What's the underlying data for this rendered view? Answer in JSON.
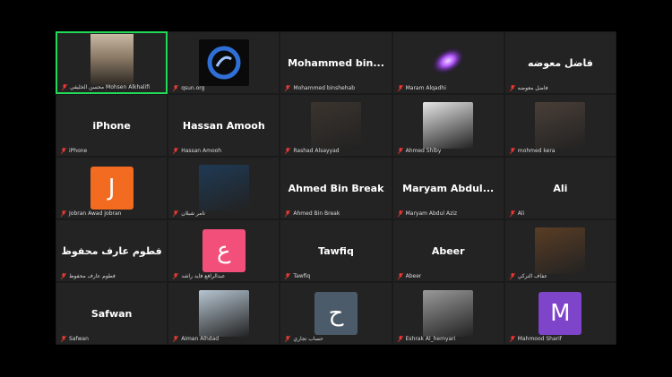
{
  "tiles": [
    {
      "label": "محسن الخليفي Mohsen Alkhalifi",
      "kind": "video",
      "active": true
    },
    {
      "label": "qsun.org",
      "kind": "logo"
    },
    {
      "label": "Mohammed binshehab",
      "center": "Mohammed  bin..."
    },
    {
      "label": "Maram Alqadhi",
      "kind": "galaxy"
    },
    {
      "label": "فاضل معوضه",
      "center": "فاضل معوضه"
    },
    {
      "label": "iPhone",
      "center": "iPhone"
    },
    {
      "label": "Hassan Amooh",
      "center": "Hassan Amooh"
    },
    {
      "label": "Rashad Alsayyad",
      "kind": "photo",
      "photo_color": "#3b342e"
    },
    {
      "label": "Ahmed Shlby",
      "kind": "photo",
      "photo_color": "#e6e6e6"
    },
    {
      "label": "mohmed kera",
      "kind": "photo",
      "photo_color": "#4a3f38"
    },
    {
      "label": "Jobran Awad Jobran",
      "kind": "avatar",
      "letter": "J",
      "avatar_color": "#f26b21"
    },
    {
      "label": "تامر شبلان",
      "kind": "photo",
      "photo_color": "#1f3a55"
    },
    {
      "label": "Ahmed Bin Break",
      "center": "Ahmed Bin Break"
    },
    {
      "label": "Maryam Abdul Aziz",
      "center": "Maryam  Abdul..."
    },
    {
      "label": "Ali",
      "center": "Ali"
    },
    {
      "label": "فطوم عارف محفوظ",
      "center": "فطوم عارف محفوظ"
    },
    {
      "label": "عبدالرافع فايد راشد",
      "kind": "avatar",
      "letter": "ع",
      "avatar_color": "#f2507b"
    },
    {
      "label": "Tawfiq",
      "center": "Tawfiq"
    },
    {
      "label": "Abeer",
      "center": "Abeer"
    },
    {
      "label": "عفاف التركي",
      "kind": "photo",
      "photo_color": "#5a3d25"
    },
    {
      "label": "Safwan",
      "center": "Safwan"
    },
    {
      "label": "Aiman Alhdad",
      "kind": "photo",
      "photo_color": "#b7c6d2"
    },
    {
      "label": "حساب تجاري",
      "kind": "avatar",
      "letter": "ح",
      "avatar_color": "#4c5b69"
    },
    {
      "label": "Eshrak Al_hemyari",
      "kind": "photo",
      "photo_color": "#9a9a9a"
    },
    {
      "label": "Mahmood Sharif",
      "kind": "avatar",
      "letter": "M",
      "avatar_color": "#7e44c9"
    }
  ],
  "colors": {
    "muted_mic": "#e53935",
    "active_border": "#23d959"
  },
  "icons": {
    "mic": "muted-mic-icon"
  }
}
